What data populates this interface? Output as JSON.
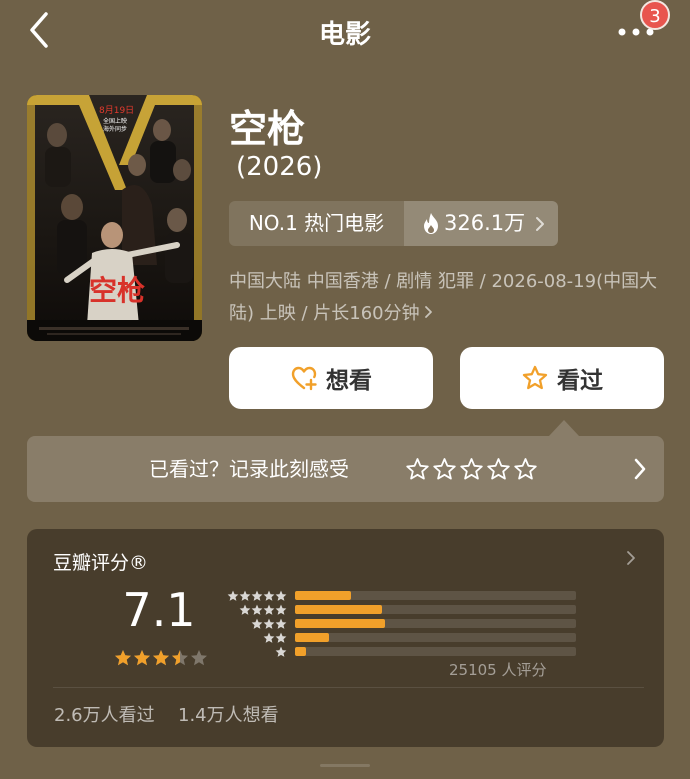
{
  "header": {
    "title": "电影",
    "badge_count": "3"
  },
  "poster": {
    "date_text": "8月19日",
    "release_line1": "全国上映",
    "release_line2": "海外同步",
    "poster_title": "空枪"
  },
  "movie": {
    "title": "空枪",
    "year": "(2026)",
    "rank_label": "NO.1 热门电影",
    "heat_value": "326.1万",
    "info": "中国大陆 中国香港 / 剧情 犯罪 / 2026-08-19(中国大陆) 上映 / 片长160分钟"
  },
  "actions": {
    "want_label": "想看",
    "seen_label": "看过"
  },
  "rate_prompt": {
    "text": "已看过？记录此刻感受"
  },
  "douban": {
    "title": "豆瓣评分®",
    "score": "7.1",
    "score_stars": 3.5,
    "distribution": [
      {
        "stars": 5,
        "fraction": 0.2
      },
      {
        "stars": 4,
        "fraction": 0.31
      },
      {
        "stars": 3,
        "fraction": 0.32
      },
      {
        "stars": 2,
        "fraction": 0.12
      },
      {
        "stars": 1,
        "fraction": 0.04
      }
    ],
    "rating_count": "25105 人评分",
    "watched": "2.6万人看过",
    "wanted": "1.4万人想看"
  },
  "colors": {
    "background": "#6f6148",
    "accent_orange": "#f1a02a",
    "badge_red": "#e8554e"
  }
}
